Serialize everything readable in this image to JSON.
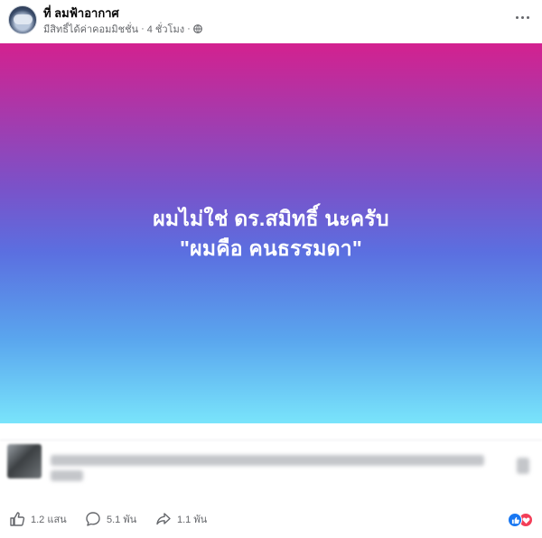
{
  "post": {
    "page_name": "ที่ ลมฟ้าอากาศ",
    "audience_text": "มีสิทธิ์ได้ค่าคอมมิชชั่น",
    "separator": "·",
    "time_ago": "4 ชั่วโมง",
    "privacy_icon": "globe-icon",
    "more_icon": "more-options-icon"
  },
  "banner": {
    "line1": "ผมไม่ใช่ ดร.สมิทธิ์ นะครับ",
    "line2": "\"ผมคือ คนธรรมดา\"",
    "gradient_colors": [
      "#d3218f",
      "#5b6fe0",
      "#79e4fb"
    ]
  },
  "actions": {
    "like_count": "1.2 แสน",
    "comment_count": "5.1 พัน",
    "share_count": "1.1 พัน",
    "reaction_icons": [
      "like-reaction-icon",
      "love-reaction-icon"
    ]
  }
}
